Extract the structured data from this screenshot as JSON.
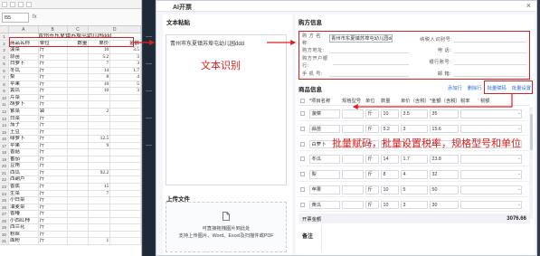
{
  "spreadsheet": {
    "cell_ref": "I55",
    "fx": "fx",
    "columns": [
      "A",
      "B",
      "C",
      "D"
    ],
    "title": "青州市东夏镇苏埠屯幼儿园ddd",
    "header": [
      "商品名称",
      "单位",
      "数量",
      "单价",
      "金额"
    ],
    "rows": [
      [
        "菠菜",
        "斤",
        "",
        "10",
        "3.5"
      ],
      [
        "蒜苗",
        "斤",
        "",
        "5.2",
        "3"
      ],
      [
        "白萝卜",
        "斤",
        "",
        "7",
        "3"
      ],
      [
        "冬瓜",
        "斤",
        "",
        "14",
        "1.7"
      ],
      [
        "梨",
        "斤",
        "",
        "8",
        "4"
      ],
      [
        "苹果",
        "斤",
        "",
        "10",
        "5"
      ],
      [
        "黄瓜",
        "斤",
        "",
        "10",
        "3"
      ],
      [
        "芹菜",
        "斤",
        "",
        "",
        ""
      ],
      [
        "胡萝卜",
        "斤",
        "",
        "",
        ""
      ],
      [
        "紫菜",
        "袋",
        "",
        "2",
        ""
      ],
      [
        "白菜",
        "斤",
        "",
        "",
        ""
      ],
      [
        "茄子",
        "斤",
        "",
        "",
        ""
      ],
      [
        "土豆",
        "斤",
        "",
        "",
        ""
      ],
      [
        "绿萝卜",
        "斤",
        "",
        "12.5",
        ""
      ],
      [
        "苹果",
        "斤",
        "",
        "9",
        ""
      ],
      [
        "香菇",
        "斤",
        "",
        "",
        ""
      ],
      [
        "番茄",
        "斤",
        "",
        "",
        ""
      ],
      [
        "豆角",
        "斤",
        "",
        "",
        ""
      ],
      [
        "西瓜",
        "斤",
        "",
        "92.2",
        ""
      ],
      [
        "西葫芦",
        "斤",
        "",
        "",
        ""
      ],
      [
        "香蕉",
        "斤",
        "",
        "15",
        ""
      ],
      [
        "生菜",
        "斤",
        "",
        "7",
        ""
      ],
      [
        "小白菜",
        "斤",
        "",
        "",
        ""
      ],
      [
        "油麦菜",
        "斤",
        "",
        "",
        ""
      ],
      [
        "香椿",
        "斤",
        "",
        "",
        ""
      ],
      [
        "小西红柿",
        "斤",
        "",
        "",
        ""
      ],
      [
        "西兰花",
        "斤",
        "",
        "",
        ""
      ],
      [
        "粉丝",
        "斤",
        "",
        "",
        ""
      ],
      [
        "面粉",
        "斤",
        "",
        "1",
        ""
      ]
    ]
  },
  "dialog": {
    "title": "AI开票",
    "close_icon": "×"
  },
  "text_paste": {
    "title": "文本粘贴",
    "content": "青州市东夏镇苏埠屯幼儿园ddd"
  },
  "upload": {
    "title": "上传文件",
    "line1": "可直接拖拽图片到此处",
    "line2": "支持上传图片、Word、Excel及扫描件或PDF"
  },
  "buyer": {
    "title": "购方信息",
    "name_label": "购 方 名 称:",
    "name_value": "青州市东夏镇苏埠屯幼儿园ddd",
    "taxid_label": "纳税人识别号:",
    "address_label": "购方地址:",
    "phone_label": "电  话:",
    "bank_label": "购方开户银行:",
    "account_label": "银行账号:",
    "mobile_label": "手    机  号:",
    "email_label": "邮  箱:"
  },
  "goods": {
    "title": "商品信息",
    "links": [
      "添加行",
      "删除行",
      "批量赋码",
      "批量设置"
    ],
    "columns": [
      "*项目名称",
      "规格型号",
      "单位",
      "数量",
      "单价（含税）",
      "*金额（含税）",
      "税率",
      "税额"
    ],
    "rows": [
      {
        "name": "菠菜",
        "unit": "斤",
        "qty": "10",
        "price": "3.5",
        "amount": "35"
      },
      {
        "name": "蒜苗",
        "unit": "斤",
        "qty": "5.2",
        "price": "3",
        "amount": "15.6"
      },
      {
        "name": "白萝卜",
        "unit": "斤",
        "qty": "7",
        "price": "3",
        "amount": "21"
      },
      {
        "name": "冬瓜",
        "unit": "斤",
        "qty": "14",
        "price": "1.7",
        "amount": "23.8"
      },
      {
        "name": "梨",
        "unit": "斤",
        "qty": "8",
        "price": "4",
        "amount": "32"
      },
      {
        "name": "苹果",
        "unit": "斤",
        "qty": "10",
        "price": "5",
        "amount": "50"
      },
      {
        "name": "黄瓜",
        "unit": "斤",
        "qty": "10",
        "price": "3",
        "amount": "30"
      }
    ],
    "total_label": "开票金额",
    "total_value": "3076.66",
    "remark_label": "备注"
  },
  "annotations": {
    "ocr": "文本识别",
    "bulk": "批量赋码，批量设置税率，规格型号和单位"
  },
  "colors": {
    "annotation_red": "#e0201f",
    "link_blue": "#2a6bd1",
    "sidebar_dark": "#1f2a38"
  }
}
